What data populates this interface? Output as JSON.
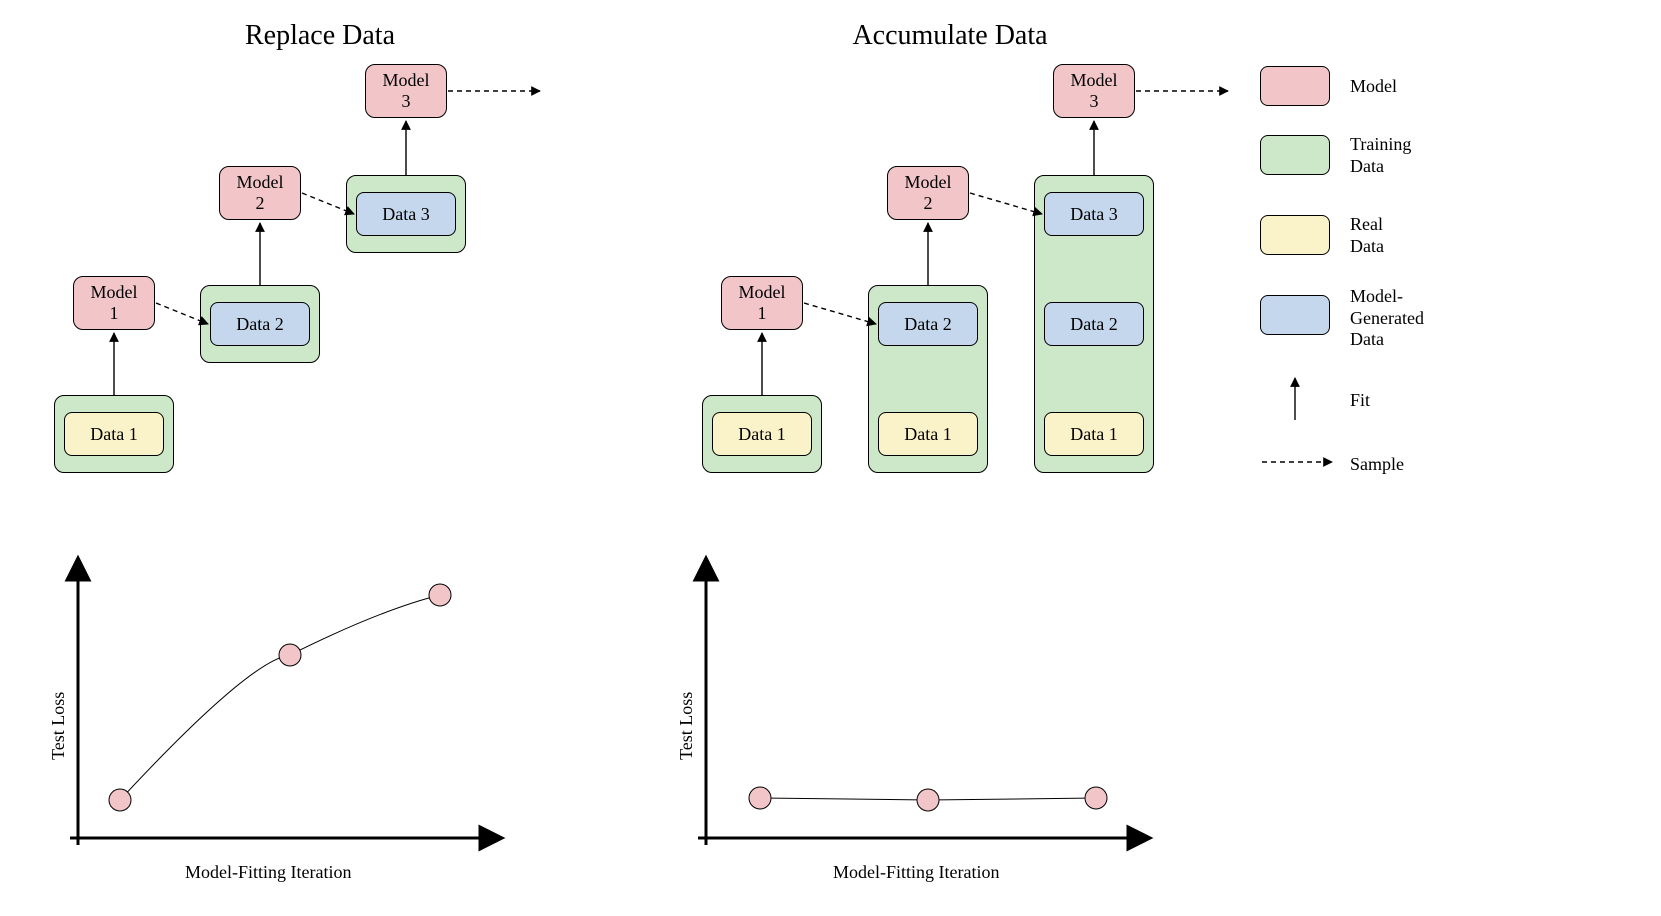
{
  "titles": {
    "left": "Replace Data",
    "right": "Accumulate Data"
  },
  "labels": {
    "model1": "Model\n1",
    "model2": "Model\n2",
    "model3": "Model\n3",
    "data1": "Data 1",
    "data2": "Data 2",
    "data3": "Data 3"
  },
  "legend": {
    "model": "Model",
    "training": "Training\nData",
    "real": "Real\nData",
    "generated": "Model-\nGenerated\nData",
    "fit": "Fit",
    "sample": "Sample"
  },
  "axes": {
    "y": "Test Loss",
    "x": "Model-Fitting Iteration"
  },
  "colors": {
    "model": "#f2c6c8",
    "training": "#cde7c9",
    "real": "#faf2c8",
    "generated": "#c5d7ec"
  },
  "chart_data": [
    {
      "type": "line",
      "title": "Replace Data",
      "xlabel": "Model-Fitting Iteration",
      "ylabel": "Test Loss",
      "x": [
        1,
        2,
        3
      ],
      "y": [
        1.0,
        2.4,
        3.0
      ],
      "note": "qualitative — loss increases sharply with iteration"
    },
    {
      "type": "line",
      "title": "Accumulate Data",
      "xlabel": "Model-Fitting Iteration",
      "ylabel": "Test Loss",
      "x": [
        1,
        2,
        3
      ],
      "y": [
        1.0,
        1.0,
        1.0
      ],
      "note": "qualitative — loss stays flat with iteration"
    }
  ]
}
